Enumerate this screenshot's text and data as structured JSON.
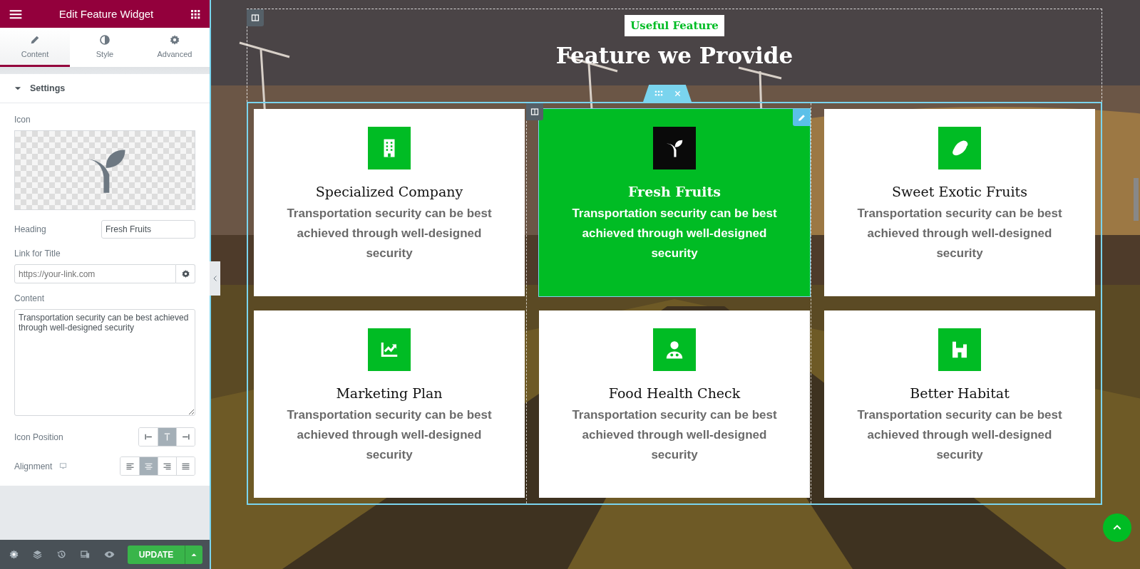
{
  "panel": {
    "title": "Edit Feature Widget",
    "tabs": [
      {
        "label": "Content",
        "kind": "pencil",
        "selected": true
      },
      {
        "label": "Style",
        "kind": "contrast",
        "selected": false
      },
      {
        "label": "Advanced",
        "kind": "gear",
        "selected": false
      }
    ],
    "section": {
      "title": "Settings",
      "expanded": true
    },
    "icon_field": {
      "label": "Icon"
    },
    "heading_field": {
      "label": "Heading",
      "value": "Fresh Fruits"
    },
    "link_field": {
      "label": "Link for Title",
      "placeholder": "https://your-link.com"
    },
    "content_field": {
      "label": "Content",
      "value": "Transportation security can be best achieved through well-designed security"
    },
    "icon_position": {
      "label": "Icon Position",
      "options": [
        {
          "kind": "left",
          "selected": false
        },
        {
          "kind": "top",
          "selected": true
        },
        {
          "kind": "right",
          "selected": false
        }
      ]
    },
    "alignment": {
      "label": "Alignment",
      "options": [
        {
          "kind": "left",
          "selected": false
        },
        {
          "kind": "center",
          "selected": true
        },
        {
          "kind": "right",
          "selected": false
        },
        {
          "kind": "justify",
          "selected": false
        }
      ]
    },
    "update_button": "UPDATE"
  },
  "page": {
    "badge": "Useful Feature",
    "heading": "Feature we Provide",
    "cards": [
      {
        "kind": "building",
        "title": "Specialized Company",
        "text": "Transportation security can be best achieved through well-designed security",
        "selected": false
      },
      {
        "kind": "seedling",
        "title": "Fresh Fruits",
        "text": "Transportation security can be best achieved through well-designed security",
        "selected": true
      },
      {
        "kind": "lemon",
        "title": "Sweet Exotic Fruits",
        "text": "Transportation security can be best achieved through well-designed security",
        "selected": false
      },
      {
        "kind": "chart",
        "title": "Marketing Plan",
        "text": "Transportation security can be best achieved through well-designed security",
        "selected": false
      },
      {
        "kind": "doctor",
        "title": "Food Health Check",
        "text": "Transportation security can be best achieved through well-designed security",
        "selected": false
      },
      {
        "kind": "house",
        "title": "Better Habitat",
        "text": "Transportation security can be best achieved through well-designed security",
        "selected": false
      }
    ]
  }
}
